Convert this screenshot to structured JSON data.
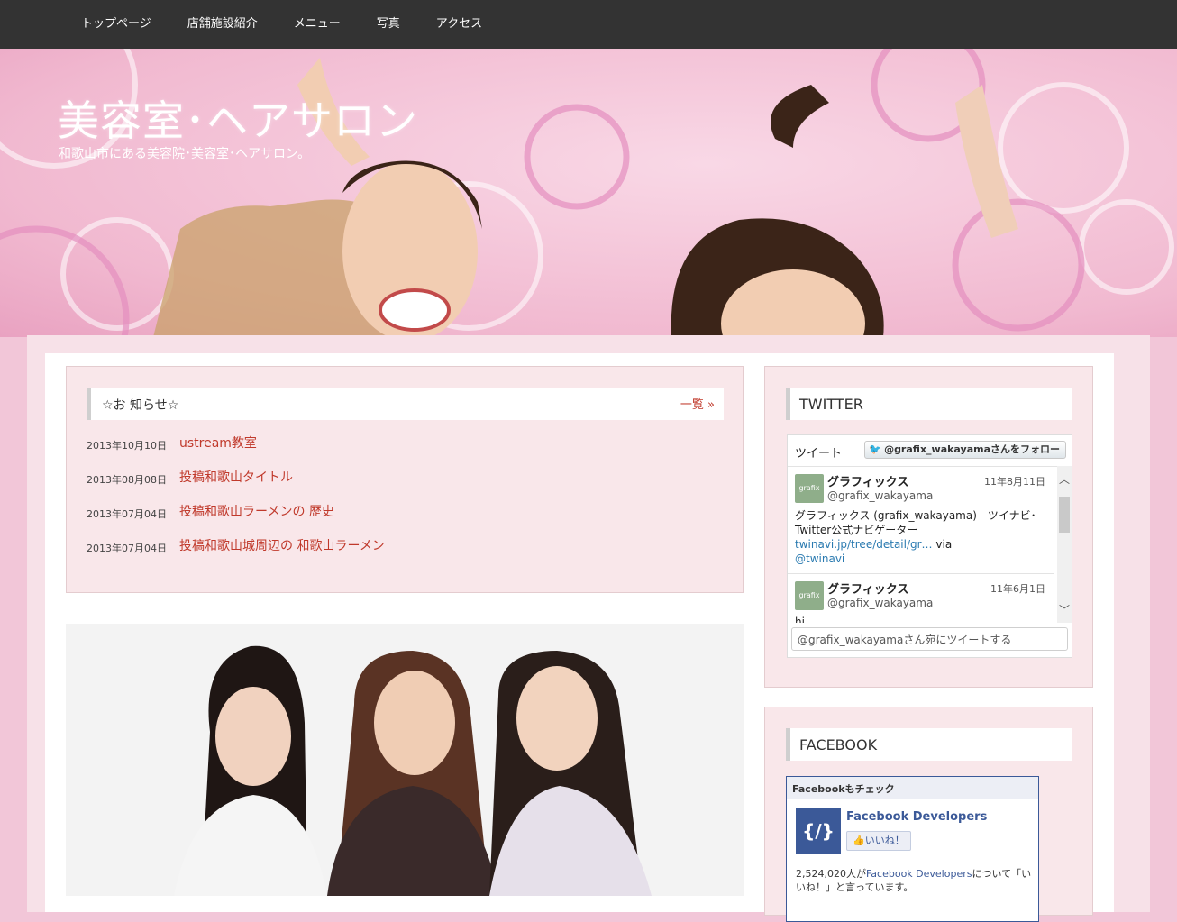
{
  "nav": {
    "items": [
      "トップページ",
      "店舗施設紹介",
      "メニュー",
      "写真",
      "アクセス"
    ]
  },
  "site": {
    "title": "美容室･ヘアサロン",
    "description": "和歌山市にある美容院･美容室･ヘアサロン。"
  },
  "news": {
    "title": "☆お 知らせ☆",
    "more_label": "一覧 »",
    "items": [
      {
        "date": "2013年10月10日",
        "title": "ustream教室"
      },
      {
        "date": "2013年08月08日",
        "title": "投稿和歌山タイトル"
      },
      {
        "date": "2013年07月04日",
        "title": "投稿和歌山ラーメンの 歴史"
      },
      {
        "date": "2013年07月04日",
        "title": "投稿和歌山城周辺の 和歌山ラーメン"
      }
    ]
  },
  "twitter": {
    "heading": "TWITTER",
    "label": "ツイート",
    "follow_label": "@grafix_wakayamaさんをフォロー",
    "tweets": [
      {
        "avatar": "grafix",
        "name": "グラフィックス",
        "handle": "@grafix_wakayama",
        "date": "11年8月11日",
        "text": "グラフィックス (grafix_wakayama) - ツイナビ･Twitter公式ナビゲーター ",
        "link": "twinavi.jp/tree/detail/gr…",
        "text_after": " via ",
        "mention": "@twinavi"
      },
      {
        "avatar": "grafix",
        "name": "グラフィックス",
        "handle": "@grafix_wakayama",
        "date": "11年6月1日",
        "text": "hi"
      }
    ],
    "reply_placeholder": "@grafix_wakayamaさん宛にツイートする",
    "icons": {
      "follow": "twitter-bird-icon",
      "scroll_up": "chevron-up-icon",
      "scroll_down": "chevron-down-icon"
    }
  },
  "facebook": {
    "heading": "FACEBOOK",
    "box_title": "Facebookもチェック",
    "page_name": "Facebook Developers",
    "like_label": "いいね！",
    "count_prefix": "2,524,020人が",
    "count_link": "Facebook Developers",
    "count_suffix": "について「いいね！」と言っています。"
  },
  "colors": {
    "nav_bg": "#333333",
    "accent": "#c0392b",
    "panel_bg": "#f9e7ea",
    "twitter_link": "#2a7ab0",
    "facebook_blue": "#3b5998"
  }
}
